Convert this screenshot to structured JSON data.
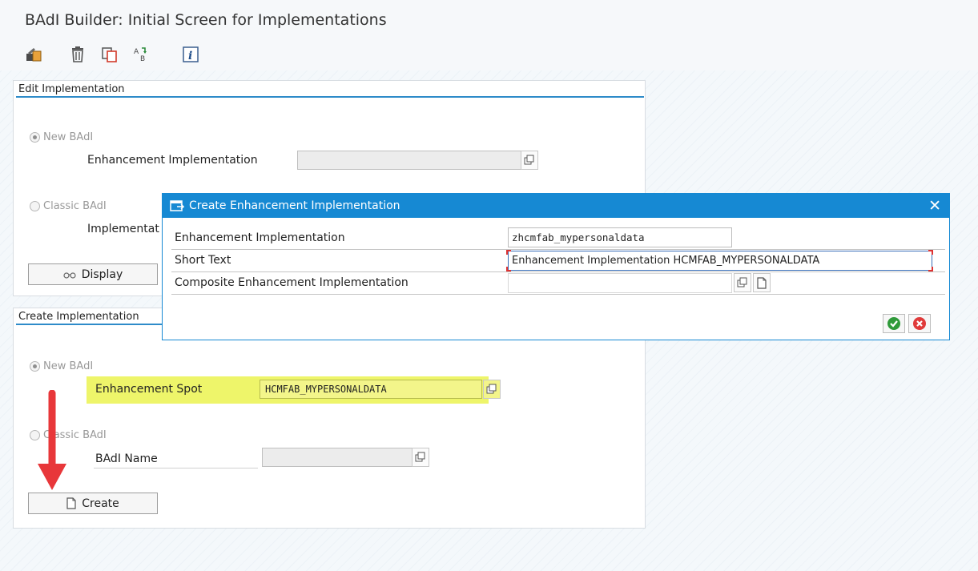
{
  "window": {
    "title": "BAdI Builder: Initial Screen for Implementations"
  },
  "toolbar": {
    "icons": [
      "change-object-icon",
      "delete-icon",
      "copy-icon",
      "rename-icon",
      "info-icon"
    ]
  },
  "edit_panel": {
    "heading": "Edit Implementation",
    "new_badi_label": "New BAdI",
    "enh_impl_label": "Enhancement Implementation",
    "enh_impl_value": "",
    "classic_badi_label": "Classic BAdI",
    "impl_label": "Implementat",
    "display_button": "Display"
  },
  "create_panel": {
    "heading": "Create Implementation",
    "new_badi_label": "New BAdI",
    "enh_spot_label": "Enhancement Spot",
    "enh_spot_value": "HCMFAB_MYPERSONALDATA",
    "classic_badi_label": "Classic BAdI",
    "badi_name_label": "BAdI Name",
    "badi_name_value": "",
    "create_button": "Create"
  },
  "dialog": {
    "title": "Create Enhancement Implementation",
    "rows": [
      {
        "label": "Enhancement Implementation",
        "value": "zhcmfab_mypersonaldata"
      },
      {
        "label": "Short Text",
        "value": "Enhancement Implementation HCMFAB_MYPERSONALDATA"
      },
      {
        "label": "Composite Enhancement Implementation",
        "value": ""
      }
    ]
  },
  "colors": {
    "accent": "#1689d3",
    "highlight": "#eef56a",
    "arrow": "#e8373a",
    "ok": "#2f9a3a",
    "cancel": "#e03a3a"
  }
}
